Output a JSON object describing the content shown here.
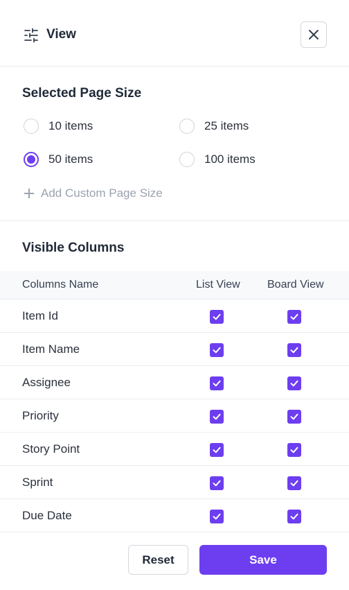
{
  "header": {
    "title": "View",
    "icon": "sliders-icon",
    "close_icon": "close-icon"
  },
  "page_size": {
    "title": "Selected Page Size",
    "options": [
      {
        "label": "10 items",
        "selected": false
      },
      {
        "label": "25 items",
        "selected": false
      },
      {
        "label": "50 items",
        "selected": true
      },
      {
        "label": "100 items",
        "selected": false
      }
    ],
    "add_custom_label": "Add Custom Page Size"
  },
  "columns": {
    "title": "Visible Columns",
    "headers": [
      "Columns Name",
      "List View",
      "Board View"
    ],
    "rows": [
      {
        "name": "Item Id",
        "list_view": true,
        "board_view": true
      },
      {
        "name": "Item Name",
        "list_view": true,
        "board_view": true
      },
      {
        "name": "Assignee",
        "list_view": true,
        "board_view": true
      },
      {
        "name": "Priority",
        "list_view": true,
        "board_view": true
      },
      {
        "name": "Story Point",
        "list_view": true,
        "board_view": true
      },
      {
        "name": "Sprint",
        "list_view": true,
        "board_view": true
      },
      {
        "name": "Due Date",
        "list_view": true,
        "board_view": true
      }
    ]
  },
  "footer": {
    "reset_label": "Reset",
    "save_label": "Save"
  },
  "colors": {
    "accent": "#6d3ef0",
    "border": "#e9ebef",
    "muted_text": "#9ca3af"
  }
}
